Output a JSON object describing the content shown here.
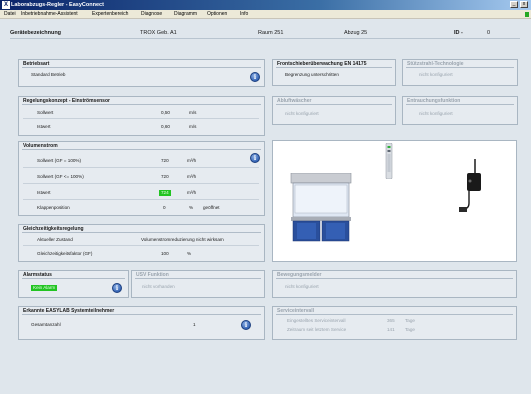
{
  "window": {
    "title": "Laborabzugs-Regler - EasyConnect",
    "icon_letter": "X"
  },
  "menu": [
    "Datei",
    "Inbetriebnahme-Assistent",
    "Expertenbereich",
    "Diagnose",
    "Diagramm",
    "Optionen",
    "Info"
  ],
  "header": {
    "device_label": "Gerätebezeichnung",
    "device_value": "TROX Geb. A1",
    "room": "Raum 251",
    "fume_hood": "Abzug 25",
    "id_label": "ID -",
    "id_value": "0"
  },
  "betriebsart": {
    "title": "Betriebsart",
    "value": "Standard Betrieb"
  },
  "regelung": {
    "title": "Regelungskonzept - Einströmsensor",
    "rows": [
      {
        "label": "Sollwert",
        "value": "0,50",
        "unit": "m/s"
      },
      {
        "label": "Istwert",
        "value": "0,60",
        "unit": "m/s"
      }
    ]
  },
  "volumenstrom": {
    "title": "Volumenstrom",
    "rows": [
      {
        "label": "Sollwert (GF = 100%)",
        "value": "720",
        "unit": "m³/h",
        "extra": ""
      },
      {
        "label": "Sollwert (GF <= 100%)",
        "value": "720",
        "unit": "m³/h",
        "extra": ""
      },
      {
        "label": "Istwert",
        "value": "724",
        "unit": "m³/h",
        "extra": ""
      },
      {
        "label": "Klappenposition",
        "value": "0",
        "unit": "%",
        "extra": "geöffnet"
      }
    ]
  },
  "gleichzeitigkeit": {
    "title": "Gleichzeitigkeitsregelung",
    "rows": [
      {
        "label": "Aktueller Zustand",
        "value": "Volumenstromreduzierung nicht wirksam",
        "unit": ""
      },
      {
        "label": "Gleichzeitigkeitsfaktor (GF)",
        "value": "100",
        "unit": "%"
      }
    ]
  },
  "alarmstatus": {
    "title": "Alarmstatus",
    "value": "Kein Alarm"
  },
  "usv": {
    "title": "USV Funktion",
    "value": "nicht vorhanden"
  },
  "teilnehmer": {
    "title": "Erkannte EASYLAB Systemteilnehmer",
    "label": "Gesamtanzahl",
    "value": "1"
  },
  "frontschieber": {
    "title": "Frontschieberüberwachung EN 14175",
    "value": "Begrenzung unterschritten"
  },
  "stuetzstrahl": {
    "title": "Stützstrahl-Technologie",
    "value": "nicht konfiguriert"
  },
  "abluftwaescher": {
    "title": "Abluftwäscher",
    "value": "nicht konfiguriert"
  },
  "entsauchung": {
    "title": "Entrauchungsfunktion",
    "value": "nicht konfiguriert"
  },
  "bewegungsmelder": {
    "title": "Bewegungsmelder",
    "value": "nicht konfiguriert"
  },
  "serviceintervall": {
    "title": "Serviceintervall",
    "rows": [
      {
        "label": "Eingestelltes Serviceintervall",
        "value": "365",
        "unit": "Tage"
      },
      {
        "label": "Zeitraum seit letztem Service",
        "value": "141",
        "unit": "Tage"
      }
    ]
  },
  "icons": {
    "info": "i",
    "minimize": "_",
    "close": "x"
  },
  "colors": {
    "ok_green": "#22c422",
    "title_blue": "#0a246a"
  }
}
